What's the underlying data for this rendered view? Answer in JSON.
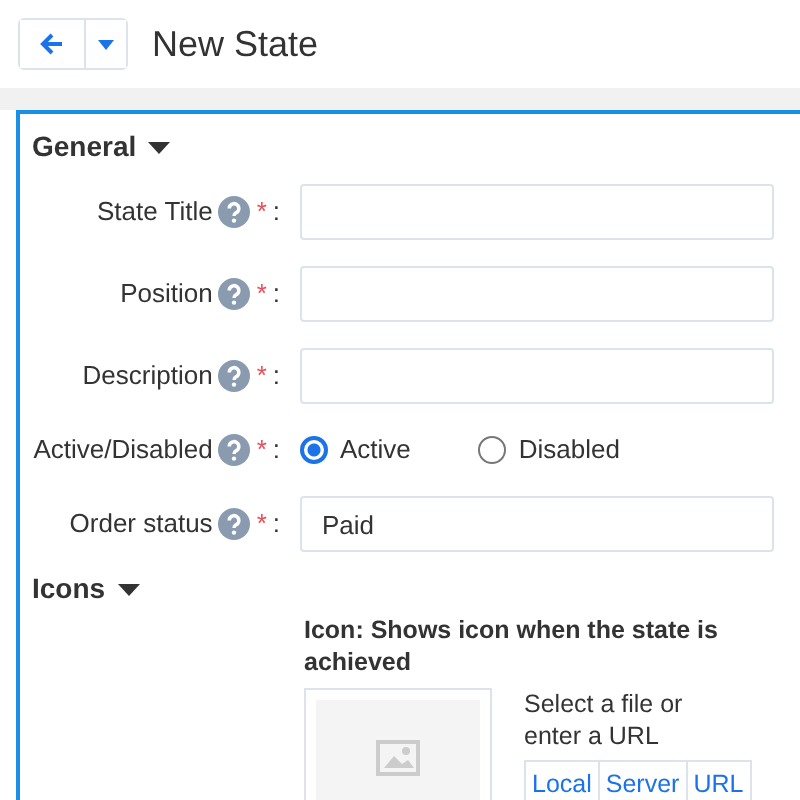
{
  "header": {
    "title": "New State"
  },
  "general": {
    "title": "General",
    "expanded": true,
    "fields": [
      {
        "kind": "text",
        "label": "State Title",
        "required_mark": "*",
        "suffix": ":"
      },
      {
        "kind": "text",
        "label": "Position",
        "required_mark": "*",
        "suffix": ":"
      },
      {
        "kind": "text",
        "label": "Description",
        "required_mark": "*",
        "suffix": ":"
      },
      {
        "kind": "radio",
        "label": "Active/Disabled",
        "required_mark": "*",
        "suffix": ":",
        "options": [
          {
            "label": "Active",
            "selected": true
          },
          {
            "label": "Disabled",
            "selected": false
          }
        ]
      },
      {
        "kind": "text",
        "label": "Order status",
        "required_mark": "*",
        "suffix": ":",
        "value": "Paid"
      }
    ]
  },
  "icons": {
    "title": "Icons",
    "expanded": true,
    "icon_field": {
      "label": "Icon: Shows icon when the state is achieved",
      "hint": "Select a file or enter a URL",
      "sources": [
        "Local",
        "Server",
        "URL"
      ]
    }
  }
}
